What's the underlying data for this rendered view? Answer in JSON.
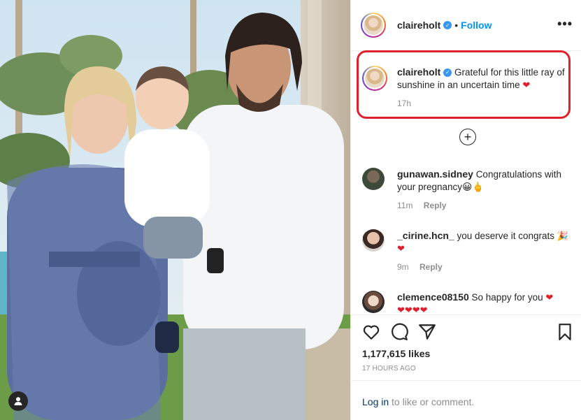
{
  "post": {
    "username": "claireholt",
    "follow_label": "Follow",
    "separator": "•",
    "more_label": "•••"
  },
  "caption": {
    "username": "claireholt",
    "text": "Grateful for this little ray of sunshine in an uncertain time",
    "emoji": "❤",
    "time": "17h"
  },
  "comments": [
    {
      "username": "gunawan.sidney",
      "text": "Congratulations with your pregnancy",
      "emoji": "😀🖕",
      "time": "11m",
      "reply": "Reply"
    },
    {
      "username": "_cirine.hcn_",
      "text": "you deserve it congrats",
      "emoji": "🎉 ❤",
      "time": "9m",
      "reply": "Reply"
    },
    {
      "username": "clemence08150",
      "text": "So happy for you",
      "emoji": "❤",
      "emoji_line2": "❤❤❤❤"
    }
  ],
  "load_more": "+",
  "likes": "1,177,615 likes",
  "time_ago": "17 HOURS AGO",
  "login": {
    "link": "Log in",
    "rest": " to like or comment."
  },
  "colors": {
    "accent": "#0095f6",
    "highlight": "#e0202c",
    "verified": "#3897f0"
  },
  "icons": [
    "heart-icon",
    "comment-icon",
    "share-icon",
    "bookmark-icon",
    "user-tag-icon",
    "verified-badge-icon",
    "more-options-icon"
  ]
}
